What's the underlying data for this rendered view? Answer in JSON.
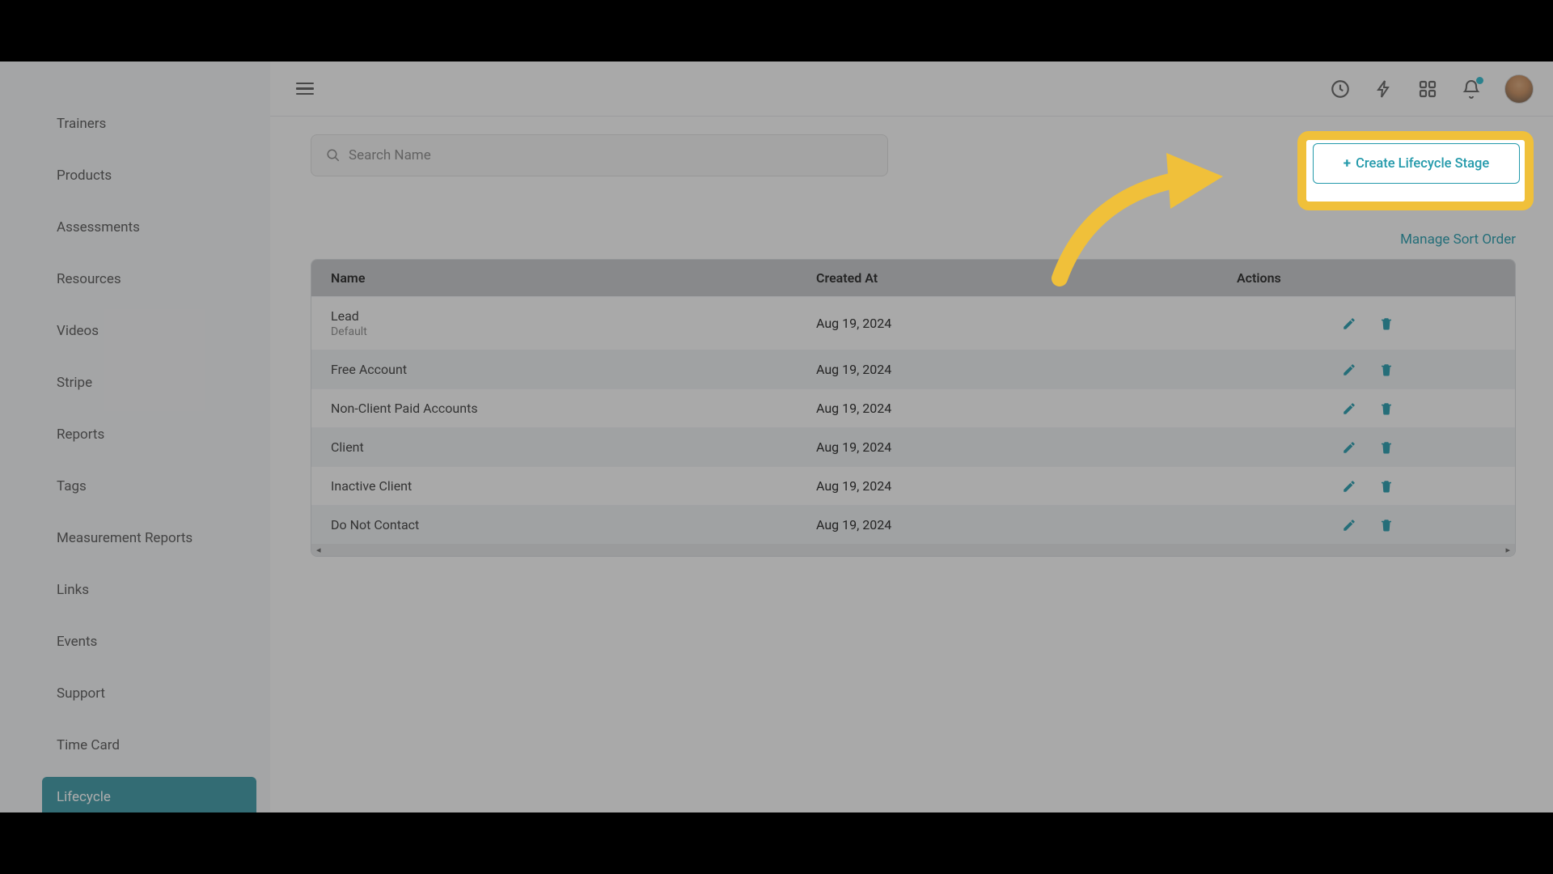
{
  "sidebar": {
    "items": [
      {
        "label": "Trainers"
      },
      {
        "label": "Products"
      },
      {
        "label": "Assessments"
      },
      {
        "label": "Resources"
      },
      {
        "label": "Videos"
      },
      {
        "label": "Stripe"
      },
      {
        "label": "Reports"
      },
      {
        "label": "Tags"
      },
      {
        "label": "Measurement Reports"
      },
      {
        "label": "Links"
      },
      {
        "label": "Events"
      },
      {
        "label": "Support"
      },
      {
        "label": "Time Card"
      },
      {
        "label": "Lifecycle"
      }
    ],
    "active_index": 13
  },
  "search": {
    "placeholder": "Search Name"
  },
  "create_button": "Create Lifecycle Stage",
  "manage_link": "Manage Sort Order",
  "table": {
    "headers": {
      "name": "Name",
      "created": "Created At",
      "actions": "Actions"
    },
    "rows": [
      {
        "name": "Lead",
        "subtext": "Default",
        "created": "Aug 19, 2024"
      },
      {
        "name": "Free Account",
        "subtext": "",
        "created": "Aug 19, 2024"
      },
      {
        "name": "Non-Client Paid Accounts",
        "subtext": "",
        "created": "Aug 19, 2024"
      },
      {
        "name": "Client",
        "subtext": "",
        "created": "Aug 19, 2024"
      },
      {
        "name": "Inactive Client",
        "subtext": "",
        "created": "Aug 19, 2024"
      },
      {
        "name": "Do Not Contact",
        "subtext": "",
        "created": "Aug 19, 2024"
      }
    ]
  },
  "colors": {
    "accent": "#249aab",
    "highlight": "#f0c03a"
  }
}
